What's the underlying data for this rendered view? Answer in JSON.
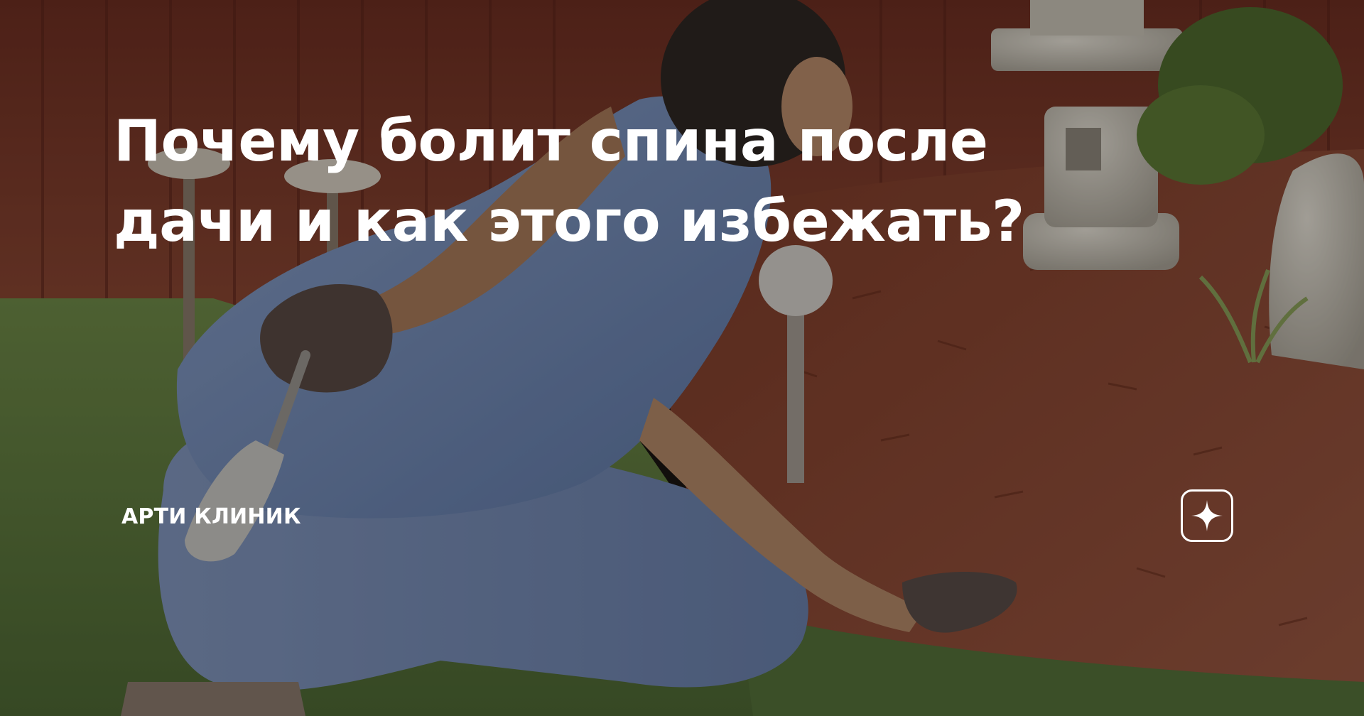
{
  "article": {
    "title_lines": [
      "Почему болит спина после",
      "дачи и как этого избежать?"
    ],
    "channel_name": "АРТИ КЛИНИК"
  },
  "icons": {
    "badge": "zen-star-icon"
  },
  "colors": {
    "text": "#ffffff",
    "fence": "#7d3d2c",
    "mulch": "#8a4a36",
    "grass": "#5e7a3e",
    "shirt": "#6d86b2",
    "overlay": "rgba(0,0,0,0.30)"
  }
}
